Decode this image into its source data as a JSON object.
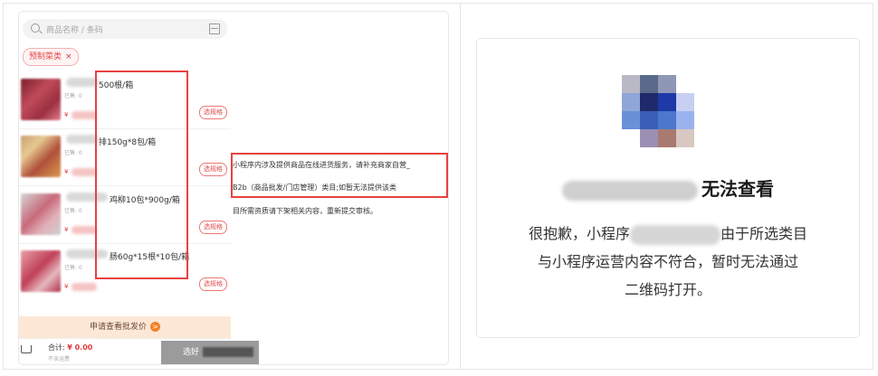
{
  "left_panel": {
    "search": {
      "placeholder": "商品名称 / 条码",
      "icon": "search-icon",
      "scan_icon": "scan-icon"
    },
    "category_tag": {
      "label": "预制菜类",
      "close": "×"
    },
    "products": [
      {
        "name": "500根/箱",
        "sold": "已售: 0",
        "price_prefix": "¥",
        "spec_button": "选规格"
      },
      {
        "name": "排150g*8包/箱",
        "sold": "已售: 0",
        "price_prefix": "¥",
        "spec_button": "选规格"
      },
      {
        "name": "鸡柳10包*900g/箱",
        "sold": "已售: 0",
        "price_prefix": "¥",
        "spec_button": "选规格"
      },
      {
        "name": "肠60g*15根*10包/箱",
        "sold": "已售: 0",
        "price_prefix": "¥",
        "spec_button": "选规格"
      }
    ],
    "banner": {
      "label": "申请查看批发价",
      "icon": ">"
    },
    "footer": {
      "total_label": "合计:",
      "total_amount": "¥ 0.00",
      "shipping": "不含运费",
      "choose_button": "选好"
    },
    "notice": {
      "line1": "小程序内涉及提供商品在线进货服务，请补充商家自营_",
      "line2": "B2b（商品批发/门店管理）类目;如暂无法提供该类",
      "line3": "目所需资质请下架相关内容，重新提交审核。"
    }
  },
  "right_panel": {
    "title_suffix": "无法查看",
    "desc_line1_prefix": "很抱歉，小程序",
    "desc_line1_suffix": "由于所选类目",
    "desc_line2": "与小程序运营内容不符合，暂时无法通过",
    "desc_line3": "二维码打开。"
  },
  "colors": {
    "accent_red": "#e84141",
    "banner_bg": "#fde7d6",
    "banner_icon": "#f0822c"
  }
}
